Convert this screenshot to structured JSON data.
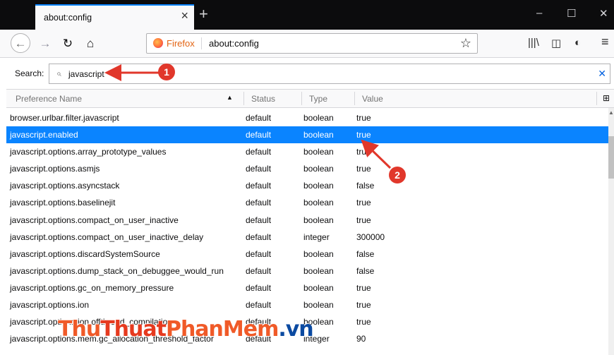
{
  "tab": {
    "title": "about:config",
    "close_icon": "×",
    "new_tab_icon": "+"
  },
  "window_controls": {
    "minimize": "–",
    "maximize": "☐",
    "close": "✕"
  },
  "nav": {
    "back_icon": "←",
    "forward_icon": "→",
    "reload_icon": "↻",
    "home_icon": "⌂",
    "identity_label": "Firefox",
    "url": "about:config",
    "bookmark_icon": "☆",
    "library_icon": "|||\\",
    "sidebar_icon": "◫",
    "account_icon": "◐",
    "menu_icon": "≡"
  },
  "search": {
    "label": "Search:",
    "query": "javascript",
    "clear_icon": "✕"
  },
  "columns": {
    "name": "Preference Name",
    "status": "Status",
    "type": "Type",
    "value": "Value",
    "sort_icon": "▲",
    "picker_icon": "⊞"
  },
  "rows": [
    {
      "name": "browser.urlbar.filter.javascript",
      "status": "default",
      "type": "boolean",
      "value": "true"
    },
    {
      "name": "javascript.enabled",
      "status": "default",
      "type": "boolean",
      "value": "true"
    },
    {
      "name": "javascript.options.array_prototype_values",
      "status": "default",
      "type": "boolean",
      "value": "true"
    },
    {
      "name": "javascript.options.asmjs",
      "status": "default",
      "type": "boolean",
      "value": "true"
    },
    {
      "name": "javascript.options.asyncstack",
      "status": "default",
      "type": "boolean",
      "value": "false"
    },
    {
      "name": "javascript.options.baselinejit",
      "status": "default",
      "type": "boolean",
      "value": "true"
    },
    {
      "name": "javascript.options.compact_on_user_inactive",
      "status": "default",
      "type": "boolean",
      "value": "true"
    },
    {
      "name": "javascript.options.compact_on_user_inactive_delay",
      "status": "default",
      "type": "integer",
      "value": "300000"
    },
    {
      "name": "javascript.options.discardSystemSource",
      "status": "default",
      "type": "boolean",
      "value": "false"
    },
    {
      "name": "javascript.options.dump_stack_on_debuggee_would_run",
      "status": "default",
      "type": "boolean",
      "value": "false"
    },
    {
      "name": "javascript.options.gc_on_memory_pressure",
      "status": "default",
      "type": "boolean",
      "value": "true"
    },
    {
      "name": "javascript.options.ion",
      "status": "default",
      "type": "boolean",
      "value": "true"
    },
    {
      "name": "javascript.options.ion.offthread_compilation",
      "status": "default",
      "type": "boolean",
      "value": "true"
    },
    {
      "name": "javascript.options.mem.gc_allocation_threshold_factor",
      "status": "default",
      "type": "integer",
      "value": "90"
    }
  ],
  "selected_row": 1,
  "annotations": {
    "badge_1": "1",
    "badge_2": "2"
  },
  "watermark": {
    "part1": "Thu",
    "part2": "Thuat",
    "part3": "PhanMem",
    "part4": ".vn"
  },
  "colors": {
    "selection": "#0a84ff",
    "annotation": "#e1372b",
    "firefox_brand": "#e36413"
  }
}
